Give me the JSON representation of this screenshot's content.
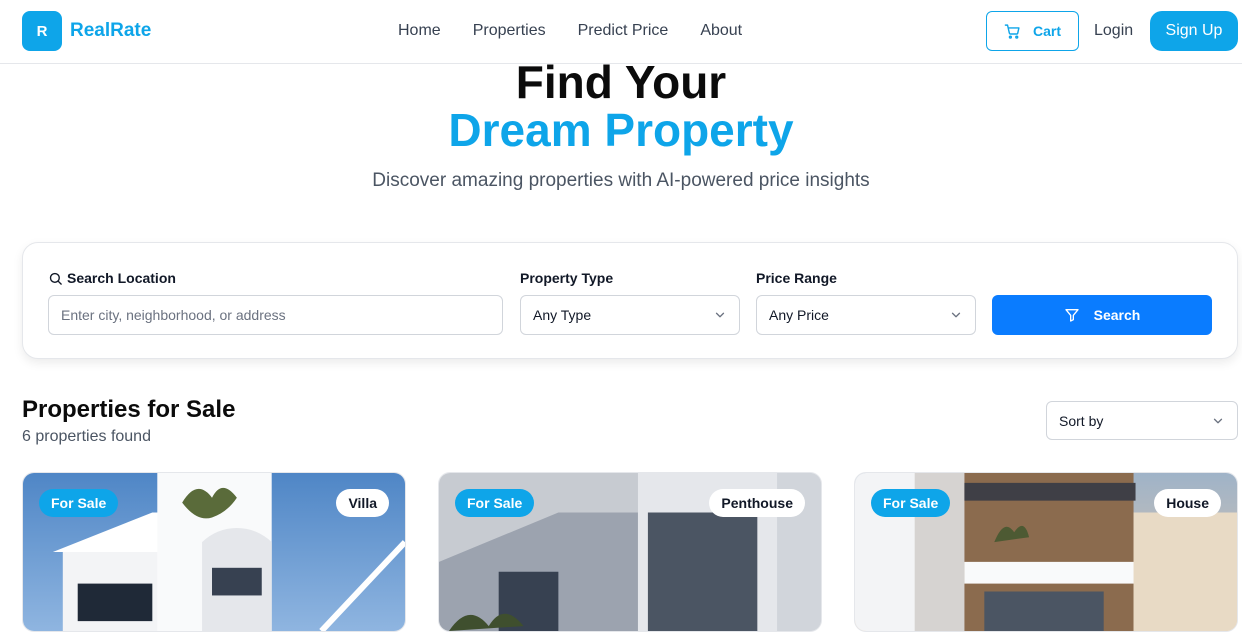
{
  "brand": {
    "logo_letter": "R",
    "name": "RealRate"
  },
  "nav": {
    "links": [
      "Home",
      "Properties",
      "Predict Price",
      "About"
    ],
    "cart_label": "Cart",
    "login_label": "Login",
    "signup_label": "Sign Up"
  },
  "hero": {
    "line1": "Find Your",
    "line2": "Dream Property",
    "subtitle": "Discover amazing properties with AI-powered price insights"
  },
  "search": {
    "location_label": "Search Location",
    "location_placeholder": "Enter city, neighborhood, or address",
    "type_label": "Property Type",
    "type_value": "Any Type",
    "price_label": "Price Range",
    "price_value": "Any Price",
    "button_label": "Search"
  },
  "listing": {
    "title": "Properties for Sale",
    "count": "6 properties found",
    "sort_label": "Sort by"
  },
  "cards": [
    {
      "status": "For Sale",
      "type": "Villa"
    },
    {
      "status": "For Sale",
      "type": "Penthouse"
    },
    {
      "status": "For Sale",
      "type": "House"
    }
  ],
  "colors": {
    "brand": "#0ea5e9",
    "search_button": "#0a7cff"
  }
}
